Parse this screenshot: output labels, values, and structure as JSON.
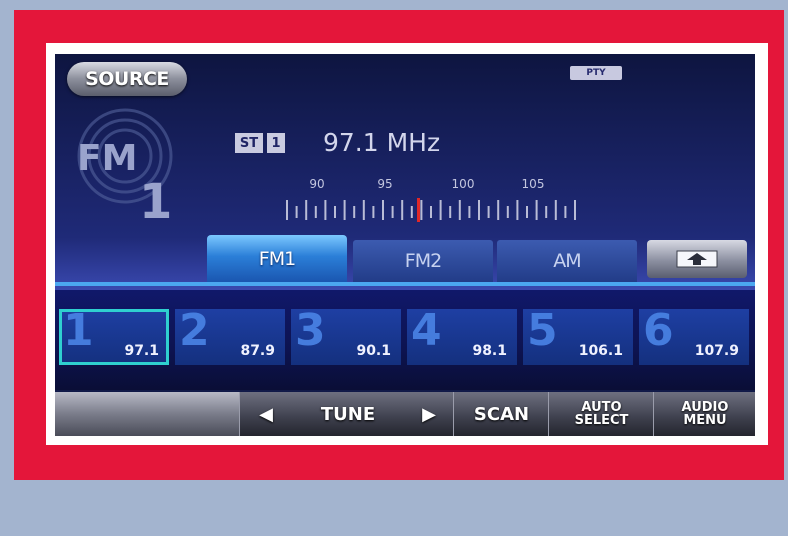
{
  "header": {
    "source_label": "SOURCE",
    "pty_label": "PTY"
  },
  "band_badge": {
    "band": "FM",
    "number": "1"
  },
  "status": {
    "stereo_label": "ST",
    "channel_label": "1",
    "frequency": "97.1 MHz"
  },
  "scale": {
    "labels": [
      "90",
      "95",
      "100",
      "105"
    ]
  },
  "tabs": [
    {
      "label": "FM1",
      "active": true
    },
    {
      "label": "FM2",
      "active": false
    },
    {
      "label": "AM",
      "active": false
    }
  ],
  "presets": [
    {
      "number": "1",
      "frequency": "97.1",
      "selected": true
    },
    {
      "number": "2",
      "frequency": "87.9",
      "selected": false
    },
    {
      "number": "3",
      "frequency": "90.1",
      "selected": false
    },
    {
      "number": "4",
      "frequency": "98.1",
      "selected": false
    },
    {
      "number": "5",
      "frequency": "106.1",
      "selected": false
    },
    {
      "number": "6",
      "frequency": "107.9",
      "selected": false
    }
  ],
  "bottom_bar": {
    "tune_left_icon": "◀",
    "tune_label": "TUNE",
    "tune_right_icon": "▶",
    "scan_label": "SCAN",
    "auto_select_line1": "AUTO",
    "auto_select_line2": "SELECT",
    "audio_menu_line1": "AUDIO",
    "audio_menu_line2": "MENU"
  },
  "icons": {
    "up_arrow": "eject-up-icon",
    "fm_badge": "fm-broadcast-icon"
  },
  "colors": {
    "frame_red": "#e4163a",
    "active_tab": "#2b7fd8",
    "preset_selected_border": "#2fd0d0",
    "tuning_needle": "#e02828"
  }
}
